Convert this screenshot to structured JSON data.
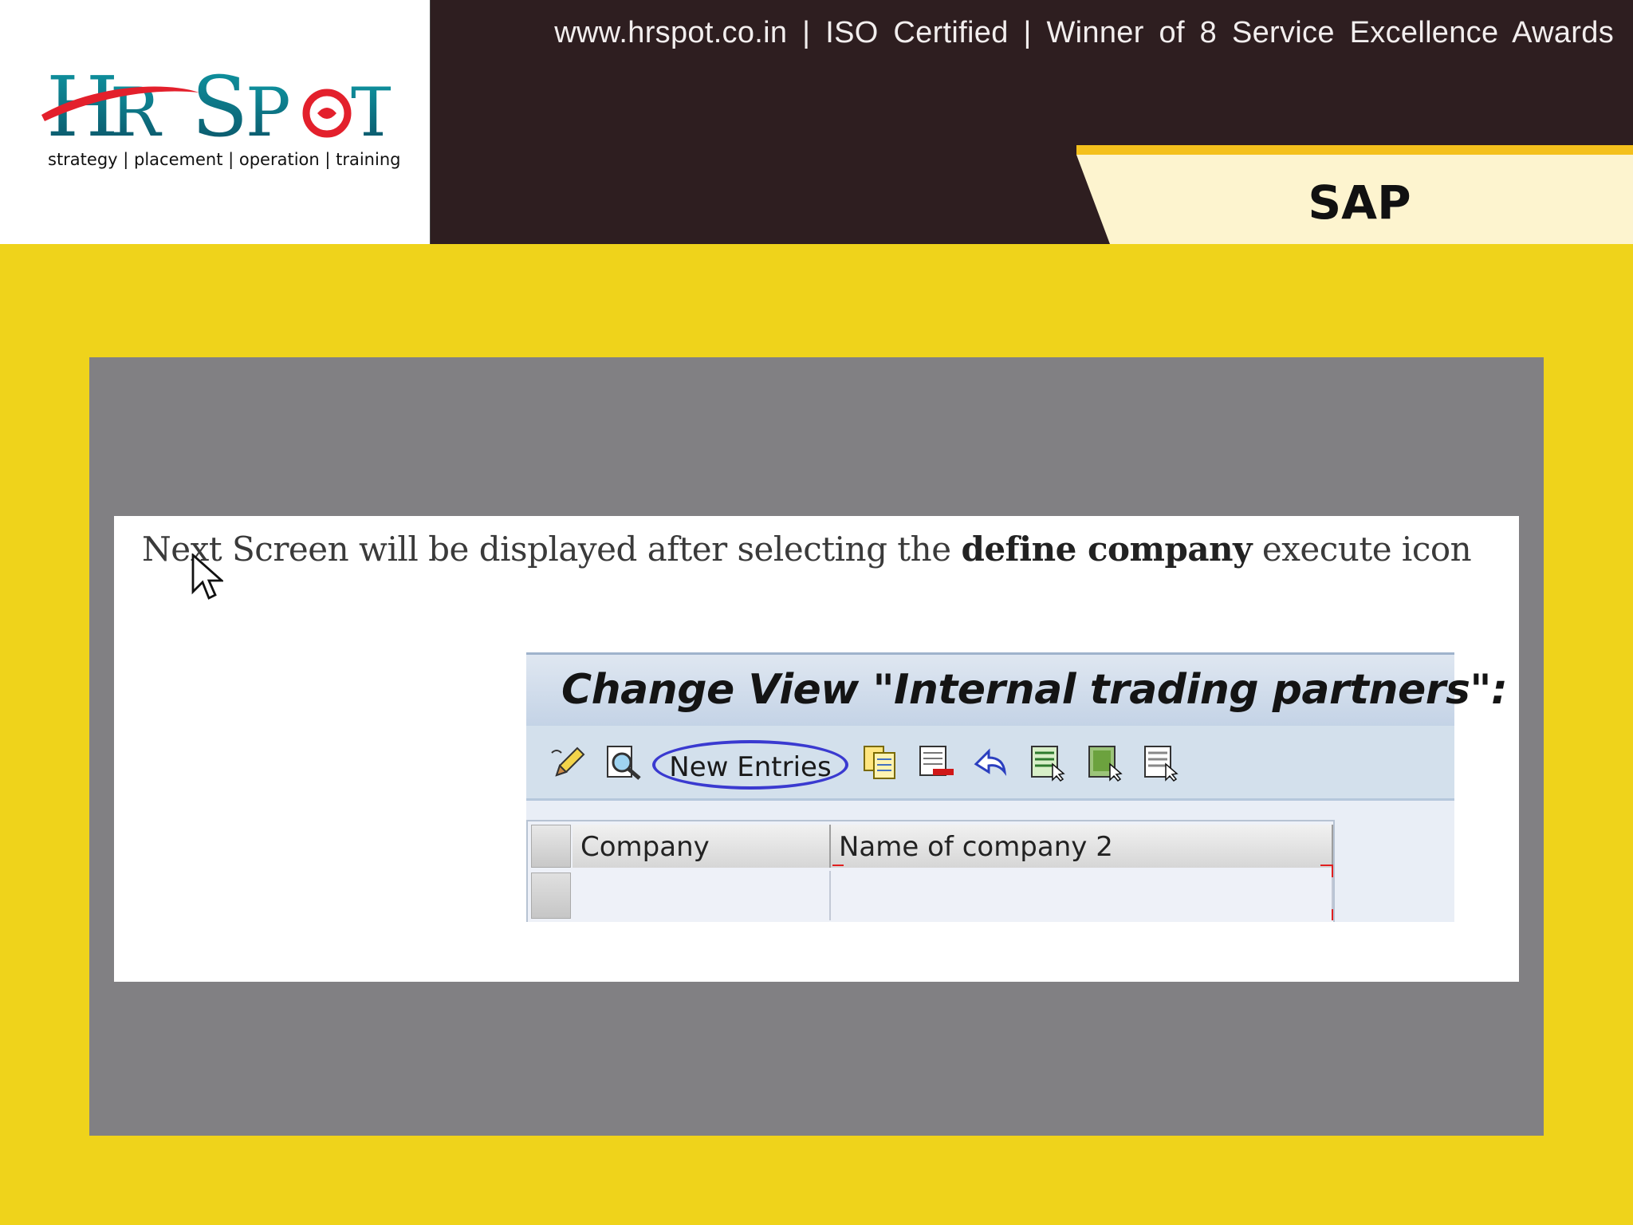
{
  "header": {
    "logo": {
      "text": "HR SPOT",
      "tagline": "strategy | placement | operation | training"
    },
    "tagline": "www.hrspot.co.in  |  ISO Certified  |  Winner of 8 Service Excellence Awards",
    "section": "SAP"
  },
  "slide": {
    "caption_pre": "Next Screen will be displayed after selecting the ",
    "caption_bold": "define company",
    "caption_post": " execute icon"
  },
  "sap_screen": {
    "title": "Change View \"Internal trading partners\":",
    "toolbar": {
      "new_entries_label": "New Entries",
      "icons": [
        "edit-pencil-icon",
        "display-glasses-icon",
        "copy-as-icon",
        "delete-icon",
        "undo-change-icon",
        "select-all-icon",
        "select-block-icon",
        "deselect-all-icon"
      ]
    },
    "table": {
      "columns": [
        "Company",
        "Name of company 2"
      ],
      "rows": [
        [
          "",
          ""
        ]
      ]
    }
  },
  "colors": {
    "page_background": "#efd31b",
    "header_background": "#2e1e20",
    "panel_gray": "#818083",
    "highlight_ellipse": "#3a3ad0"
  }
}
